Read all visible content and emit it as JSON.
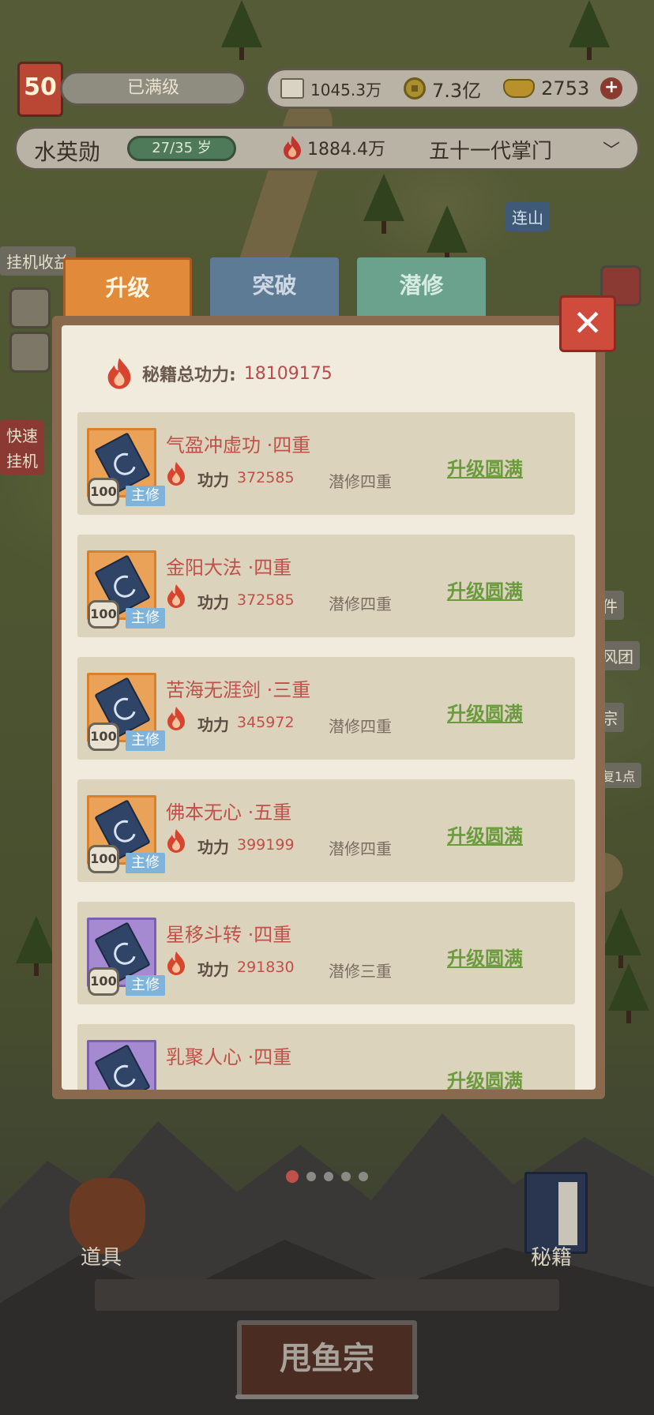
{
  "hud": {
    "level": "50",
    "level_status": "已满级",
    "resources": {
      "book_value": "1045.3万",
      "coin_value": "7.3亿",
      "ingot_value": "2753",
      "plus_label": "+"
    },
    "player_name": "水英勋",
    "age": "27/35 岁",
    "power": "1884.4万",
    "rank": "五十一代掌门",
    "rank_chevron": "﹀"
  },
  "map_labels": {
    "place": "连山",
    "idle": "挂机收益",
    "quick_line1": "快速",
    "quick_line2": "挂机",
    "right_1": "件",
    "right_2": "风团",
    "right_3": "宗",
    "right_4": "复1点"
  },
  "tabs": [
    {
      "label": "升级",
      "active": true
    },
    {
      "label": "突破",
      "active": false
    },
    {
      "label": "潜修",
      "active": false
    }
  ],
  "close_label": "✕",
  "total": {
    "label": "秘籍总功力:",
    "value": "18109175"
  },
  "skills": [
    {
      "name": "气盈冲虚功 ·四重",
      "power_label": "功力",
      "power": "372585",
      "qianxiu": "潜修四重",
      "status": "升级圆满",
      "level": "100",
      "tag": "主修",
      "rarity": "orange"
    },
    {
      "name": "金阳大法 ·四重",
      "power_label": "功力",
      "power": "372585",
      "qianxiu": "潜修四重",
      "status": "升级圆满",
      "level": "100",
      "tag": "主修",
      "rarity": "orange"
    },
    {
      "name": "苦海无涯剑 ·三重",
      "power_label": "功力",
      "power": "345972",
      "qianxiu": "潜修四重",
      "status": "升级圆满",
      "level": "100",
      "tag": "主修",
      "rarity": "orange"
    },
    {
      "name": "佛本无心 ·五重",
      "power_label": "功力",
      "power": "399199",
      "qianxiu": "潜修四重",
      "status": "升级圆满",
      "level": "100",
      "tag": "主修",
      "rarity": "orange"
    },
    {
      "name": "星移斗转 ·四重",
      "power_label": "功力",
      "power": "291830",
      "qianxiu": "潜修三重",
      "status": "升级圆满",
      "level": "100",
      "tag": "主修",
      "rarity": "purple"
    },
    {
      "name": "乳聚人心 ·四重",
      "power_label": "功力",
      "power": "",
      "qianxiu": "",
      "status": "升级圆满",
      "level": "",
      "tag": "",
      "rarity": "purple"
    }
  ],
  "bottom": {
    "items_label": "道具",
    "books_label": "秘籍",
    "sect_name": "甩鱼宗"
  },
  "colors": {
    "accent_orange": "#e08a3a",
    "complete_green": "#6b9b3e",
    "value_red": "#c0504a",
    "close_red": "#cf4b3c"
  }
}
